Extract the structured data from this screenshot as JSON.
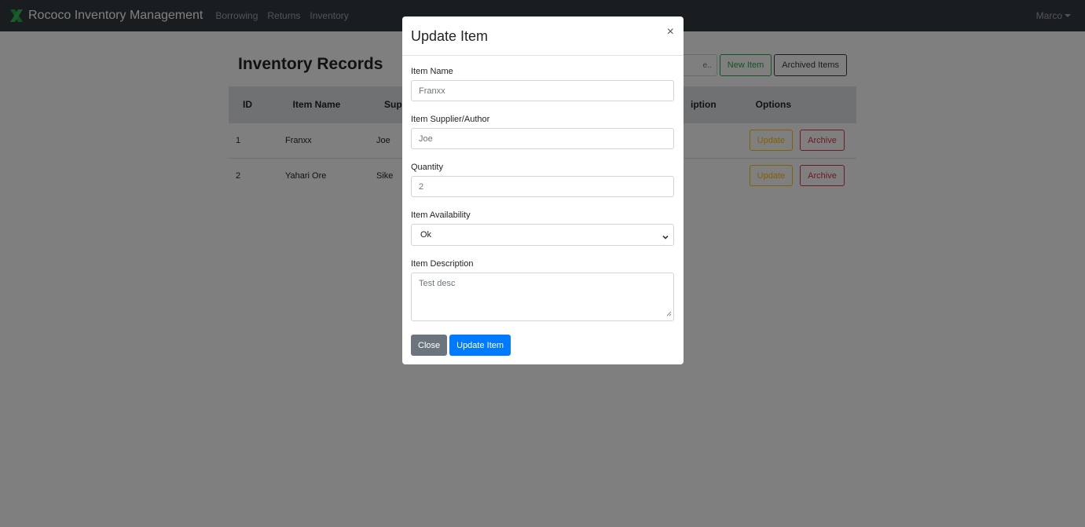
{
  "navbar": {
    "brand": "Rococo Inventory Management",
    "links": [
      "Borrowing",
      "Returns",
      "Inventory"
    ],
    "user": "Marco"
  },
  "page": {
    "title": "Inventory Records",
    "search_placeholder": "Search table...",
    "search_visible_text": "e..",
    "new_item_label": "New Item",
    "archived_items_label": "Archived Items"
  },
  "table": {
    "headers": [
      "ID",
      "Item Name",
      "Sup",
      "iption",
      "Options"
    ],
    "rows": [
      {
        "id": "1",
        "name": "Franxx",
        "supplier": "Joe",
        "update": "Update",
        "archive": "Archive"
      },
      {
        "id": "2",
        "name": "Yahari Ore",
        "supplier": "Sike",
        "update": "Update",
        "archive": "Archive"
      }
    ]
  },
  "modal": {
    "title": "Update Item",
    "close_symbol": "×",
    "fields": {
      "name_label": "Item Name",
      "name_value": "Franxx",
      "supplier_label": "Item Supplier/Author",
      "supplier_value": "Joe",
      "quantity_label": "Quantity",
      "quantity_value": "2",
      "availability_label": "Item Availability",
      "availability_value": "Ok",
      "description_label": "Item Description",
      "description_value": "Test desc"
    },
    "close_button": "Close",
    "submit_button": "Update Item"
  },
  "colors": {
    "navbar": "#343a40",
    "primary": "#007bff",
    "success": "#28a745",
    "warning": "#ffc107",
    "danger": "#dc3545",
    "logo": "#28a745"
  }
}
